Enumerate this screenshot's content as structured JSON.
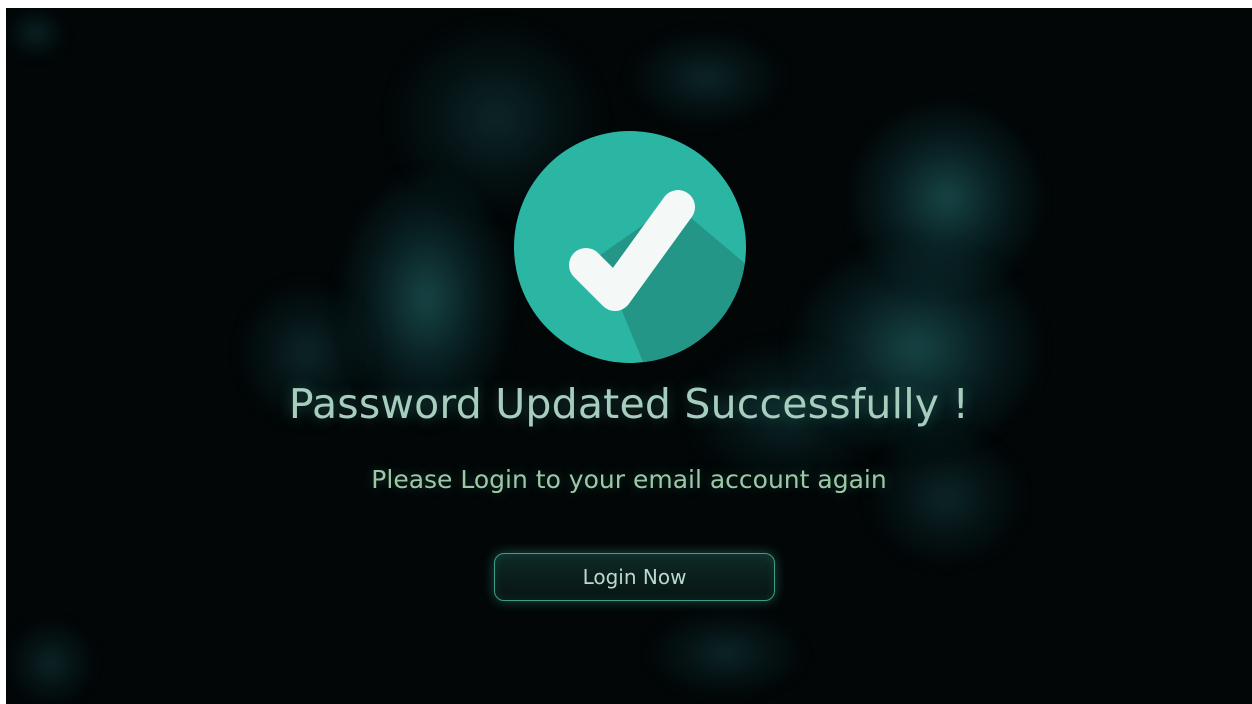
{
  "status": {
    "icon": "check-circle-icon",
    "title": "Password Updated Successfully !",
    "subtitle": "Please Login to your email account again"
  },
  "actions": {
    "login_label": "Login Now"
  },
  "colors": {
    "background": "#020607",
    "badge": "#2bb5a3",
    "badge_shadow": "#239687",
    "title_text": "#a6cdbd",
    "subtitle_text": "#9cc8a8",
    "button_border": "#3f9c88"
  }
}
